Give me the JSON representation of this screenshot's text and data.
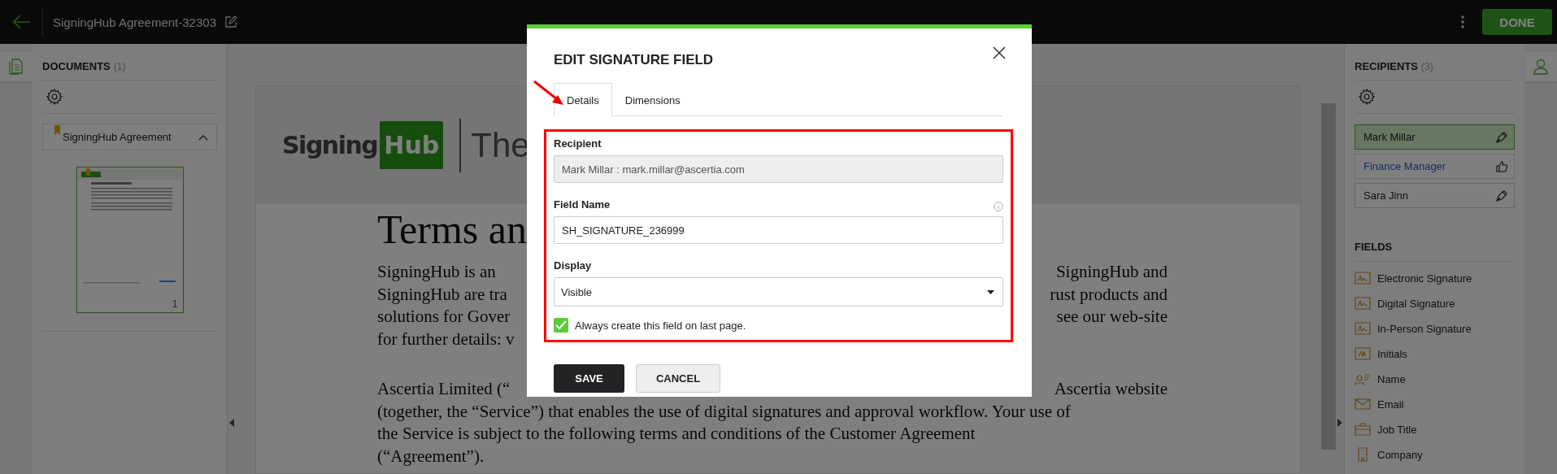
{
  "topbar": {
    "title": "SigningHub Agreement-32303",
    "done_button": "DONE"
  },
  "documents_panel": {
    "heading": "DOCUMENTS",
    "count": "(1)",
    "document": {
      "name": "SigningHub Agreement",
      "expanded": true
    },
    "thumbnail": {
      "page_number": "1",
      "selected": true
    }
  },
  "document_page": {
    "logo": {
      "word": "Signing",
      "badge": "Hub"
    },
    "tagline": "The",
    "title": "Terms an",
    "paragraphs": [
      {
        "lines": [
          {
            "left": "SigningHub is an",
            "right": "SigningHub and"
          },
          {
            "left": "SigningHub are tra",
            "right": "rust products and"
          },
          {
            "left": "solutions for Gover",
            "right": "see our web-site"
          },
          {
            "left": "for further details: v"
          }
        ]
      },
      {
        "lines": [
          {
            "left": "Ascertia Limited (“",
            "right": "Ascertia website"
          },
          {
            "left": "(together, the “Service”) that enables the use of digital signatures and approval workflow. Your use of"
          },
          {
            "left": "the Service is subject to the following terms and conditions of the Customer Agreement"
          },
          {
            "left": "(“Agreement”)."
          }
        ]
      }
    ]
  },
  "modal": {
    "title": "EDIT SIGNATURE FIELD",
    "tabs": [
      {
        "label": "Details",
        "selected": true
      },
      {
        "label": "Dimensions",
        "selected": false
      }
    ],
    "recipient": {
      "label": "Recipient",
      "value": "Mark Millar : mark.millar@ascertia.com",
      "disabled": true
    },
    "field_name": {
      "label": "Field Name",
      "value": "SH_SIGNATURE_236999"
    },
    "display": {
      "label": "Display",
      "value": "Visible"
    },
    "last_page": {
      "label": "Always create this field on last page.",
      "checked": true
    },
    "buttons": [
      {
        "label": "SAVE",
        "kind": "primary"
      },
      {
        "label": "CANCEL",
        "kind": "secondary"
      }
    ]
  },
  "recipients_panel": {
    "heading": "RECIPIENTS",
    "count": "(3)",
    "recipients": [
      {
        "name": "Mark Millar",
        "kind": "signer",
        "selected": true
      },
      {
        "name": "Finance Manager",
        "kind": "approver",
        "selected": false
      },
      {
        "name": "Sara Jinn",
        "kind": "signer",
        "selected": false
      }
    ]
  },
  "fields_panel": {
    "heading": "FIELDS",
    "fields": [
      {
        "label": "Electronic Signature"
      },
      {
        "label": "Digital Signature"
      },
      {
        "label": "In-Person Signature"
      },
      {
        "label": "Initials"
      },
      {
        "label": "Name"
      },
      {
        "label": "Email"
      },
      {
        "label": "Job Title"
      },
      {
        "label": "Company"
      }
    ]
  }
}
